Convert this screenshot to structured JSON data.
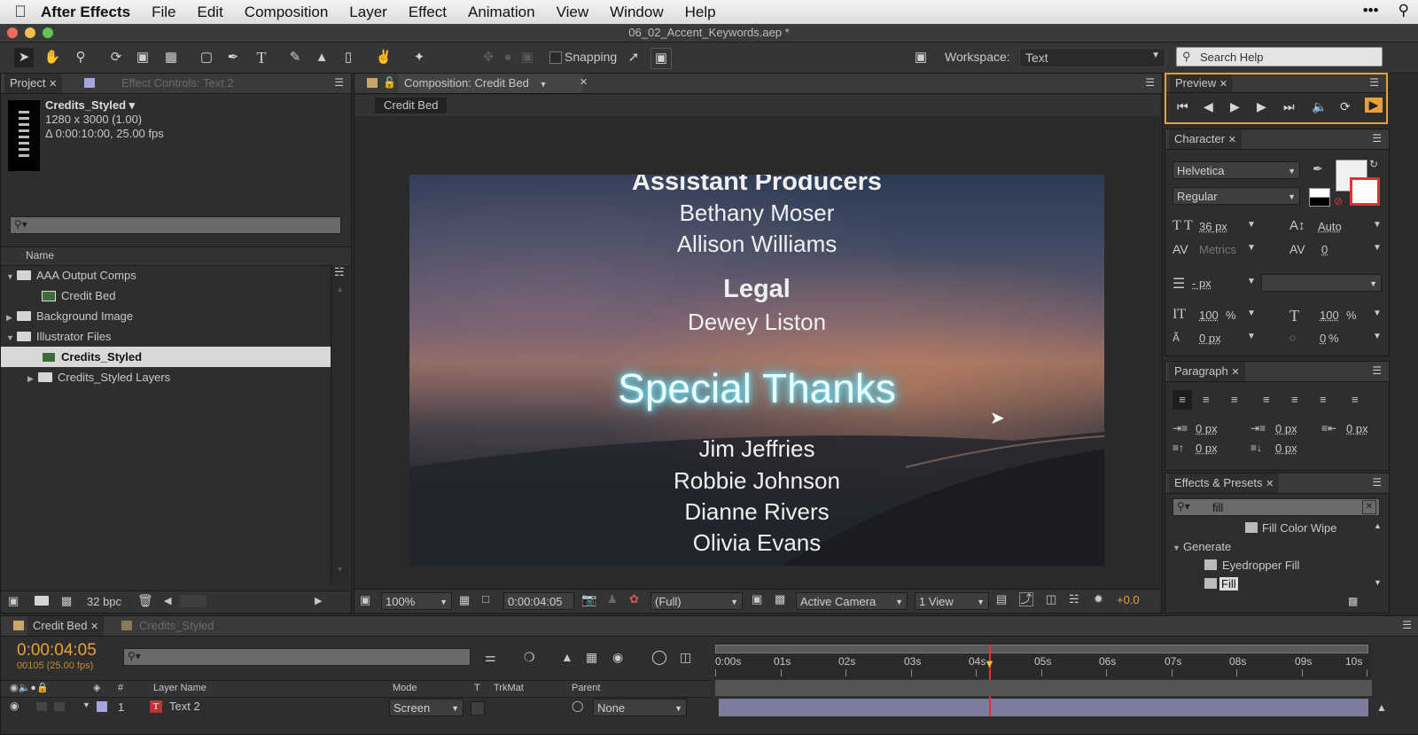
{
  "menubar": {
    "app_name": "After Effects",
    "items": [
      "File",
      "Edit",
      "Composition",
      "Layer",
      "Effect",
      "Animation",
      "View",
      "Window",
      "Help"
    ],
    "right_icons": [
      "more-icon",
      "search-icon"
    ]
  },
  "titlebar": {
    "filename": "06_02_Accent_Keywords.aep *"
  },
  "toolbar": {
    "snapping_label": "Snapping",
    "workspace_label": "Workspace:",
    "workspace_value": "Text",
    "search_placeholder": "Search Help"
  },
  "project_panel": {
    "tab_project": "Project",
    "tab_effect_controls": "Effect Controls: Text 2",
    "selected_name": "Credits_Styled ▾",
    "selected_dims": "1280 x 3000 (1.00)",
    "selected_duration": "Δ 0:00:10:00, 25.00 fps",
    "column_name": "Name",
    "items": [
      {
        "label": "AAA Output Comps",
        "type": "folder",
        "expanded": true
      },
      {
        "label": "Credit Bed",
        "type": "comp"
      },
      {
        "label": "Background Image",
        "type": "folder",
        "expanded": false
      },
      {
        "label": "Illustrator Files",
        "type": "folder",
        "expanded": true
      },
      {
        "label": "Credits_Styled",
        "type": "comp",
        "selected": true
      },
      {
        "label": "Credits_Styled Layers",
        "type": "folder",
        "expanded": false
      }
    ],
    "bpc": "32 bpc"
  },
  "composition_panel": {
    "tab_label": "Composition: Credit Bed",
    "breadcrumb": "Credit Bed",
    "credits": {
      "heading1": "Assistant Producers",
      "names1": [
        "Bethany Moser",
        "Allison Williams"
      ],
      "heading2": "Legal",
      "names2": [
        "Dewey Liston"
      ],
      "heading3": "Special Thanks",
      "names3": [
        "Jim Jeffries",
        "Robbie Johnson",
        "Dianne Rivers",
        "Olivia Evans"
      ]
    },
    "footer": {
      "zoom": "100%",
      "timecode": "0:00:04:05",
      "resolution": "(Full)",
      "camera": "Active Camera",
      "views": "1 View",
      "exposure": "+0.0"
    }
  },
  "preview_panel": {
    "tab_label": "Preview"
  },
  "character_panel": {
    "tab_label": "Character",
    "font": "Helvetica",
    "style": "Regular",
    "size": "36 px",
    "leading": "Auto",
    "kerning": "Metrics",
    "tracking": "0",
    "stroke_width": "- px",
    "vertical_scale": "100",
    "horizontal_scale": "100",
    "baseline_shift": "0 px",
    "tsume": "0",
    "percent": "%"
  },
  "paragraph_panel": {
    "tab_label": "Paragraph",
    "indent_left": "0 px",
    "indent_first": "0 px",
    "indent_right": "0 px",
    "space_before": "0 px",
    "space_after": "0 px"
  },
  "effects_panel": {
    "tab_label": "Effects & Presets",
    "search_value": "fill",
    "items": [
      {
        "label": "Fill Color Wipe",
        "type": "preset"
      },
      {
        "label": "Generate",
        "type": "category"
      },
      {
        "label": "Eyedropper Fill",
        "type": "effect"
      },
      {
        "label": "Fill",
        "type": "effect",
        "selected": true
      }
    ]
  },
  "timeline": {
    "tab_active": "Credit Bed",
    "tab_other": "Credits_Styled",
    "current_time": "0:00:04:05",
    "frame_info": "00105 (25.00 fps)",
    "ruler_ticks": [
      "0:00s",
      "01s",
      "02s",
      "03s",
      "04s",
      "05s",
      "06s",
      "07s",
      "08s",
      "09s",
      "10s"
    ],
    "columns": {
      "layer_name": "Layer Name",
      "mode": "Mode",
      "t": "T",
      "trkmat": "TrkMat",
      "parent": "Parent",
      "number": "#"
    },
    "layer": {
      "number": "1",
      "name": "Text 2",
      "mode": "Screen",
      "parent": "None"
    },
    "playhead_fraction": 0.42
  },
  "colors": {
    "accent": "#e8a13a",
    "glow": "#7fe8ff",
    "selection": "#d8d8d8"
  }
}
